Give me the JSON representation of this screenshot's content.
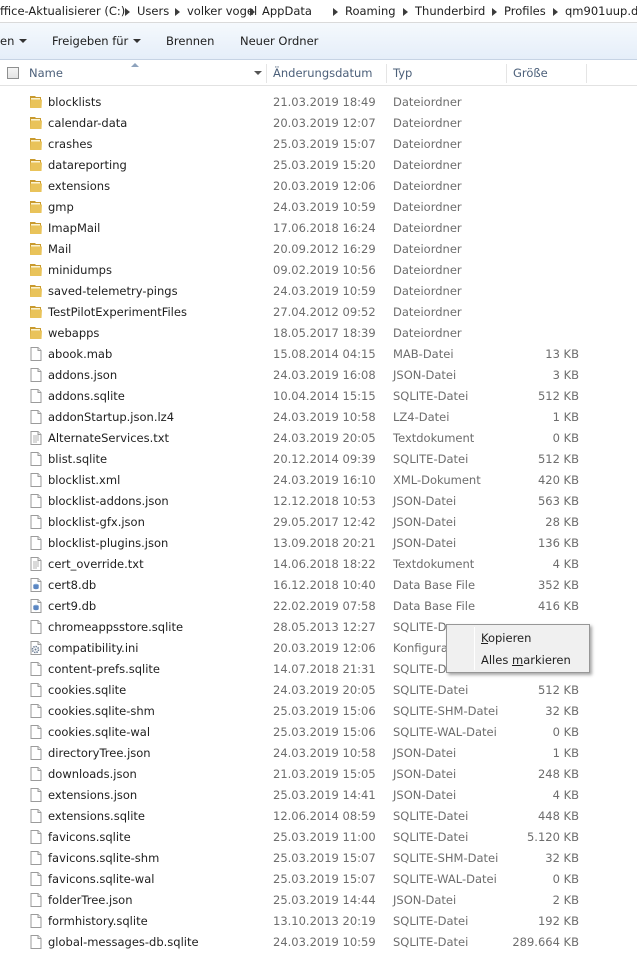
{
  "breadcrumb": [
    {
      "label": "ffice-Aktualisierer (C:)"
    },
    {
      "label": "Users"
    },
    {
      "label": "volker vogel"
    },
    {
      "label": "AppData"
    },
    {
      "label": "Roaming"
    },
    {
      "label": "Thunderbird"
    },
    {
      "label": "Profiles"
    },
    {
      "label": "qm901uup.de"
    }
  ],
  "toolbar": {
    "organize_label": "en",
    "share_label": "Freigeben für",
    "burn_label": "Brennen",
    "new_folder_label": "Neuer Ordner"
  },
  "columns": {
    "name": "Name",
    "date": "Änderungsdatum",
    "type": "Typ",
    "size": "Größe"
  },
  "files": [
    {
      "name": "blocklists",
      "date": "21.03.2019 18:49",
      "type": "Dateiordner",
      "size": "",
      "icon": "folder-icon"
    },
    {
      "name": "calendar-data",
      "date": "20.03.2019 12:07",
      "type": "Dateiordner",
      "size": "",
      "icon": "folder-icon"
    },
    {
      "name": "crashes",
      "date": "25.03.2019 15:07",
      "type": "Dateiordner",
      "size": "",
      "icon": "folder-icon"
    },
    {
      "name": "datareporting",
      "date": "25.03.2019 15:20",
      "type": "Dateiordner",
      "size": "",
      "icon": "folder-icon"
    },
    {
      "name": "extensions",
      "date": "20.03.2019 12:06",
      "type": "Dateiordner",
      "size": "",
      "icon": "folder-icon"
    },
    {
      "name": "gmp",
      "date": "24.03.2019 10:59",
      "type": "Dateiordner",
      "size": "",
      "icon": "folder-icon"
    },
    {
      "name": "ImapMail",
      "date": "17.06.2018 16:24",
      "type": "Dateiordner",
      "size": "",
      "icon": "folder-icon"
    },
    {
      "name": "Mail",
      "date": "20.09.2012 16:29",
      "type": "Dateiordner",
      "size": "",
      "icon": "folder-icon"
    },
    {
      "name": "minidumps",
      "date": "09.02.2019 10:56",
      "type": "Dateiordner",
      "size": "",
      "icon": "folder-icon"
    },
    {
      "name": "saved-telemetry-pings",
      "date": "24.03.2019 10:59",
      "type": "Dateiordner",
      "size": "",
      "icon": "folder-icon"
    },
    {
      "name": "TestPilotExperimentFiles",
      "date": "27.04.2012 09:52",
      "type": "Dateiordner",
      "size": "",
      "icon": "folder-icon"
    },
    {
      "name": "webapps",
      "date": "18.05.2017 18:39",
      "type": "Dateiordner",
      "size": "",
      "icon": "folder-icon"
    },
    {
      "name": "abook.mab",
      "date": "15.08.2014 04:15",
      "type": "MAB-Datei",
      "size": "13 KB",
      "icon": "file-icon"
    },
    {
      "name": "addons.json",
      "date": "24.03.2019 16:08",
      "type": "JSON-Datei",
      "size": "3 KB",
      "icon": "file-icon"
    },
    {
      "name": "addons.sqlite",
      "date": "10.04.2014 15:15",
      "type": "SQLITE-Datei",
      "size": "512 KB",
      "icon": "file-icon"
    },
    {
      "name": "addonStartup.json.lz4",
      "date": "24.03.2019 10:58",
      "type": "LZ4-Datei",
      "size": "1 KB",
      "icon": "file-icon"
    },
    {
      "name": "AlternateServices.txt",
      "date": "24.03.2019 20:05",
      "type": "Textdokument",
      "size": "0 KB",
      "icon": "text-file-icon"
    },
    {
      "name": "blist.sqlite",
      "date": "20.12.2014 09:39",
      "type": "SQLITE-Datei",
      "size": "512 KB",
      "icon": "file-icon"
    },
    {
      "name": "blocklist.xml",
      "date": "24.03.2019 16:10",
      "type": "XML-Dokument",
      "size": "420 KB",
      "icon": "file-icon"
    },
    {
      "name": "blocklist-addons.json",
      "date": "12.12.2018 10:53",
      "type": "JSON-Datei",
      "size": "563 KB",
      "icon": "file-icon"
    },
    {
      "name": "blocklist-gfx.json",
      "date": "29.05.2017 12:42",
      "type": "JSON-Datei",
      "size": "28 KB",
      "icon": "file-icon"
    },
    {
      "name": "blocklist-plugins.json",
      "date": "13.09.2018 20:21",
      "type": "JSON-Datei",
      "size": "136 KB",
      "icon": "file-icon"
    },
    {
      "name": "cert_override.txt",
      "date": "14.06.2018 18:22",
      "type": "Textdokument",
      "size": "4 KB",
      "icon": "text-file-icon"
    },
    {
      "name": "cert8.db",
      "date": "16.12.2018 10:40",
      "type": "Data Base File",
      "size": "352 KB",
      "icon": "database-file-icon"
    },
    {
      "name": "cert9.db",
      "date": "22.02.2019 07:58",
      "type": "Data Base File",
      "size": "416 KB",
      "icon": "database-file-icon"
    },
    {
      "name": "chromeappsstore.sqlite",
      "date": "28.05.2013 12:27",
      "type": "SQLITE-Da",
      "size": "",
      "icon": "file-icon"
    },
    {
      "name": "compatibility.ini",
      "date": "20.03.2019 12:06",
      "type": "Konfigurat",
      "size": "",
      "icon": "settings-file-icon"
    },
    {
      "name": "content-prefs.sqlite",
      "date": "14.07.2018 21:31",
      "type": "SQLITE-Da",
      "size": "",
      "icon": "file-icon"
    },
    {
      "name": "cookies.sqlite",
      "date": "24.03.2019 20:05",
      "type": "SQLITE-Datei",
      "size": "512 KB",
      "icon": "file-icon"
    },
    {
      "name": "cookies.sqlite-shm",
      "date": "25.03.2019 15:06",
      "type": "SQLITE-SHM-Datei",
      "size": "32 KB",
      "icon": "file-icon"
    },
    {
      "name": "cookies.sqlite-wal",
      "date": "25.03.2019 15:06",
      "type": "SQLITE-WAL-Datei",
      "size": "0 KB",
      "icon": "file-icon"
    },
    {
      "name": "directoryTree.json",
      "date": "24.03.2019 10:58",
      "type": "JSON-Datei",
      "size": "1 KB",
      "icon": "file-icon"
    },
    {
      "name": "downloads.json",
      "date": "21.03.2019 15:05",
      "type": "JSON-Datei",
      "size": "248 KB",
      "icon": "file-icon"
    },
    {
      "name": "extensions.json",
      "date": "25.03.2019 14:41",
      "type": "JSON-Datei",
      "size": "4 KB",
      "icon": "file-icon"
    },
    {
      "name": "extensions.sqlite",
      "date": "12.06.2014 08:59",
      "type": "SQLITE-Datei",
      "size": "448 KB",
      "icon": "file-icon"
    },
    {
      "name": "favicons.sqlite",
      "date": "25.03.2019 11:00",
      "type": "SQLITE-Datei",
      "size": "5.120 KB",
      "icon": "file-icon"
    },
    {
      "name": "favicons.sqlite-shm",
      "date": "25.03.2019 15:07",
      "type": "SQLITE-SHM-Datei",
      "size": "32 KB",
      "icon": "file-icon"
    },
    {
      "name": "favicons.sqlite-wal",
      "date": "25.03.2019 15:07",
      "type": "SQLITE-WAL-Datei",
      "size": "0 KB",
      "icon": "file-icon"
    },
    {
      "name": "folderTree.json",
      "date": "25.03.2019 14:44",
      "type": "JSON-Datei",
      "size": "2 KB",
      "icon": "file-icon"
    },
    {
      "name": "formhistory.sqlite",
      "date": "13.10.2013 20:19",
      "type": "SQLITE-Datei",
      "size": "192 KB",
      "icon": "file-icon"
    },
    {
      "name": "global-messages-db.sqlite",
      "date": "24.03.2019 10:59",
      "type": "SQLITE-Datei",
      "size": "289.664 KB",
      "icon": "file-icon"
    }
  ],
  "context_menu": {
    "copy_accel": "K",
    "copy_rest": "opieren",
    "select_all_pre": "Alles ",
    "select_all_accel": "m",
    "select_all_rest": "arkieren"
  },
  "colors": {
    "folder": "#e9c35a",
    "folder_dark": "#c99a2e",
    "header_text": "#4c607a",
    "secondary_text": "#6d6d6d"
  }
}
